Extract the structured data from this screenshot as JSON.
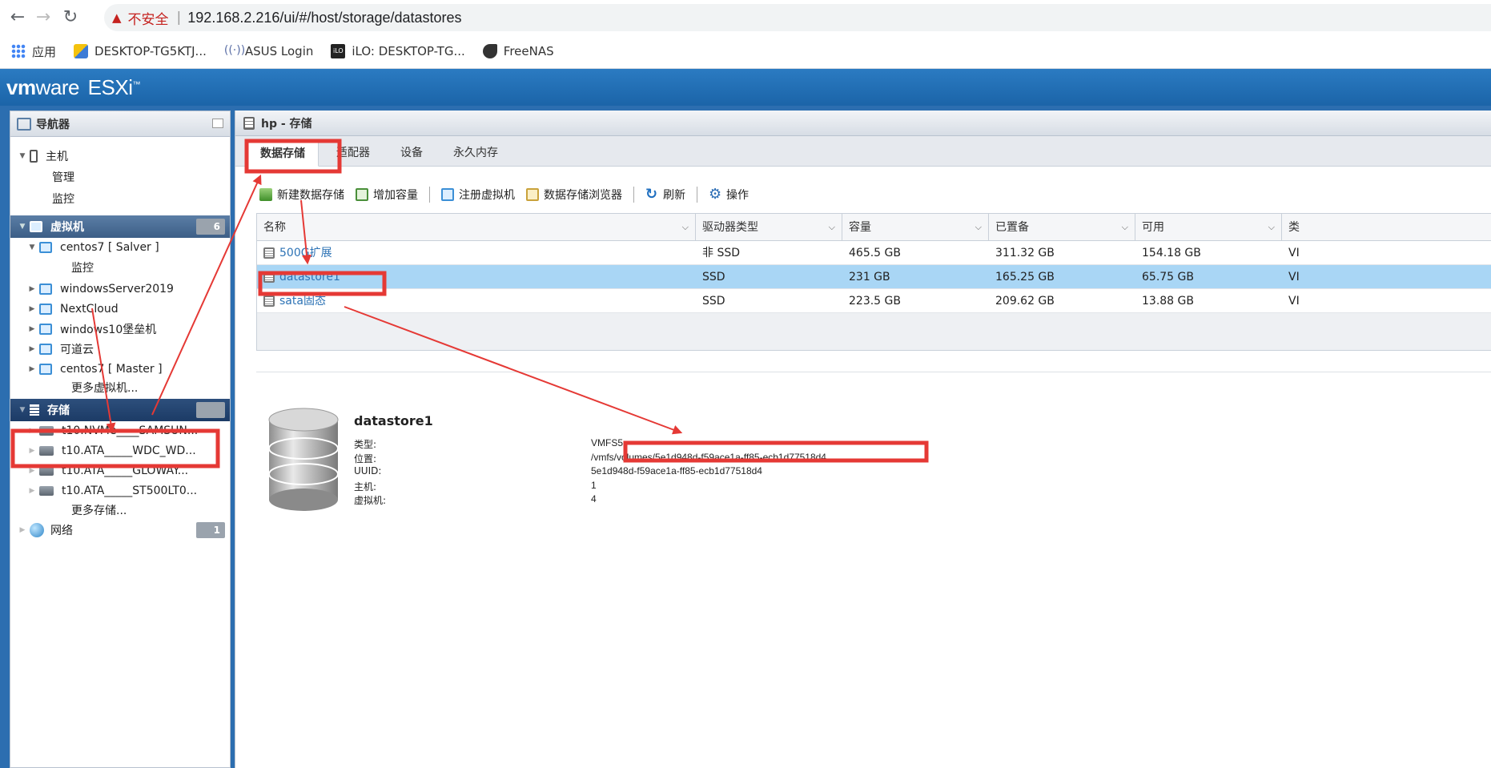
{
  "browser": {
    "back": "←",
    "forward": "→",
    "reload": "↻",
    "security_icon": "warning-triangle-icon",
    "security_text": "不安全",
    "url": "192.168.2.216/ui/#/host/storage/datastores",
    "bookmarks": [
      {
        "label": "应用",
        "icon": "apps-grid-icon"
      },
      {
        "label": "DESKTOP-TG5KTJ...",
        "icon": "folder-key-icon"
      },
      {
        "label": "ASUS Login",
        "icon": "wifi-icon"
      },
      {
        "label": "iLO: DESKTOP-TG...",
        "icon": "ilo-icon"
      },
      {
        "label": "FreeNAS",
        "icon": "freenas-icon"
      }
    ]
  },
  "header": {
    "logo_vm": "vm",
    "logo_ware": "ware",
    "logo_product": "ESXi",
    "tm": "™"
  },
  "navigator": {
    "title": "导航器",
    "host": {
      "label": "主机",
      "children": [
        "管理",
        "监控"
      ]
    },
    "vms": {
      "label": "虚拟机",
      "badge": "6",
      "items": [
        {
          "label": "centos7 [ Salver ]",
          "expanded": true,
          "child": "监控"
        },
        {
          "label": "windowsServer2019"
        },
        {
          "label": "NextCloud"
        },
        {
          "label": "windows10堡垒机"
        },
        {
          "label": "可道云"
        },
        {
          "label": "centos7 [ Master ]"
        }
      ],
      "more": "更多虚拟机..."
    },
    "storage": {
      "label": "存储",
      "badge": "",
      "items": [
        "t10.NVMe____SAMSUN...",
        "t10.ATA_____WDC_WD...",
        "t10.ATA_____GLOWAY...",
        "t10.ATA_____ST500LT0..."
      ],
      "more": "更多存储..."
    },
    "network": {
      "label": "网络",
      "badge": "1"
    }
  },
  "main": {
    "title": "hp - 存储",
    "tabs": [
      "数据存储",
      "适配器",
      "设备",
      "永久内存"
    ],
    "toolbar": [
      {
        "label": "新建数据存储",
        "icon": "new-datastore-icon"
      },
      {
        "label": "增加容量",
        "icon": "increase-capacity-icon"
      },
      {
        "label": "注册虚拟机",
        "icon": "register-vm-icon"
      },
      {
        "label": "数据存储浏览器",
        "icon": "datastore-browser-icon"
      },
      {
        "label": "刷新",
        "icon": "refresh-icon"
      },
      {
        "label": "操作",
        "icon": "gear-icon"
      }
    ],
    "columns": [
      "名称",
      "驱动器类型",
      "容量",
      "已置备",
      "可用",
      "类"
    ],
    "rows": [
      {
        "name": "500G扩展",
        "drive": "非 SSD",
        "capacity": "465.5 GB",
        "provisioned": "311.32 GB",
        "free": "154.18 GB",
        "type": "VI"
      },
      {
        "name": "datastore1",
        "drive": "SSD",
        "capacity": "231 GB",
        "provisioned": "165.25 GB",
        "free": "65.75 GB",
        "type": "VI",
        "selected": true
      },
      {
        "name": "sata固态",
        "drive": "SSD",
        "capacity": "223.5 GB",
        "provisioned": "209.62 GB",
        "free": "13.88 GB",
        "type": "VI"
      }
    ]
  },
  "detail": {
    "title": "datastore1",
    "fields": [
      {
        "key": "类型:",
        "value": "VMFS5"
      },
      {
        "key": "位置:",
        "value": "/vmfs/volumes/5e1d948d-f59ace1a-ff85-ecb1d77518d4"
      },
      {
        "key": "UUID:",
        "value": "5e1d948d-f59ace1a-ff85-ecb1d77518d4"
      },
      {
        "key": "主机:",
        "value": "1"
      },
      {
        "key": "虚拟机:",
        "value": "4"
      }
    ]
  },
  "colors": {
    "annotation": "#e53935",
    "accent": "#2b7bc2",
    "selected_row": "#a9d6f5"
  }
}
